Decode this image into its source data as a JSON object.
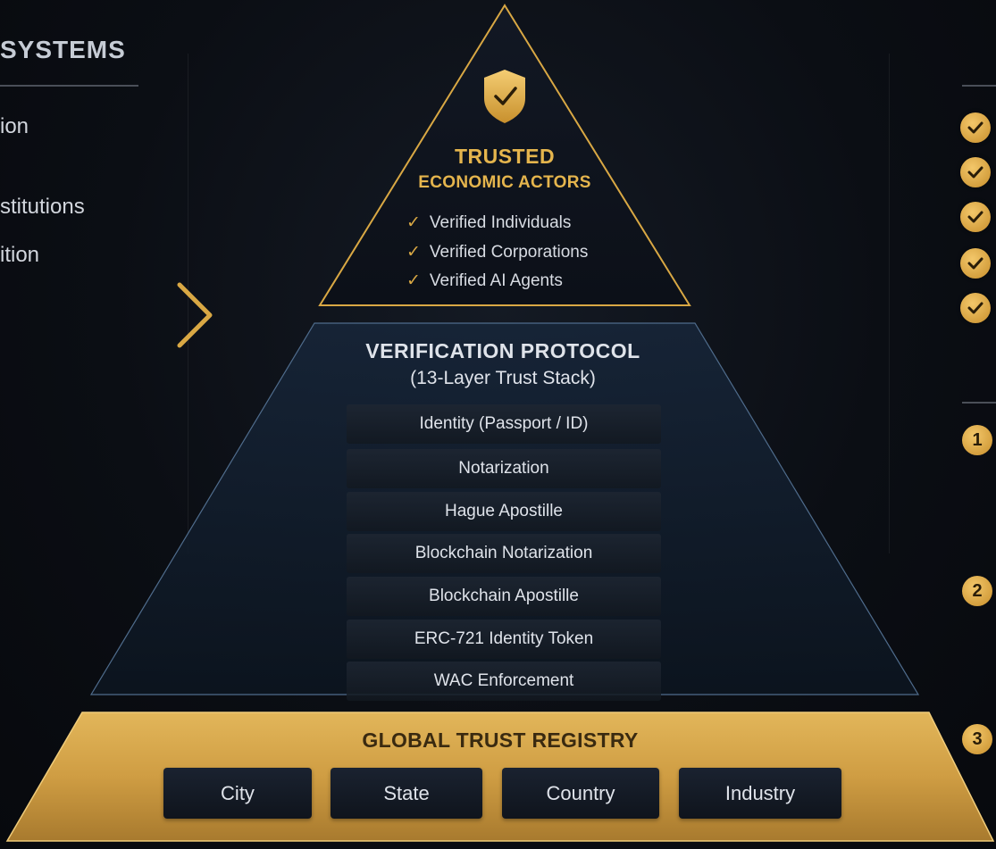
{
  "left": {
    "title": "SYSTEMS",
    "items": [
      "ion",
      "stitutions",
      "ition"
    ]
  },
  "apex": {
    "title": "TRUSTED",
    "subtitle": "ECONOMIC ACTORS",
    "items": [
      "Verified Individuals",
      "Verified Corporations",
      "Verified AI Agents"
    ],
    "check_glyph": "✓",
    "icon": "shield-check-icon"
  },
  "protocol": {
    "title": "VERIFICATION PROTOCOL",
    "subtitle": "(13-Layer Trust Stack)",
    "layers": [
      "Identity (Passport / ID)",
      "Notarization",
      "Hague Apostille",
      "Blockchain Notarization",
      "Blockchain Apostille",
      "ERC-721 Identity Token",
      "WAC Enforcement"
    ]
  },
  "registry": {
    "title": "GLOBAL TRUST REGISTRY",
    "tiles": [
      "City",
      "State",
      "Country",
      "Industry"
    ]
  },
  "right": {
    "numbers": [
      "1",
      "2",
      "3"
    ]
  },
  "colors": {
    "gold": "#e5b54d",
    "gold_dark": "#c88f2c",
    "background": "#0b0e14",
    "text": "#dfe3ea"
  }
}
